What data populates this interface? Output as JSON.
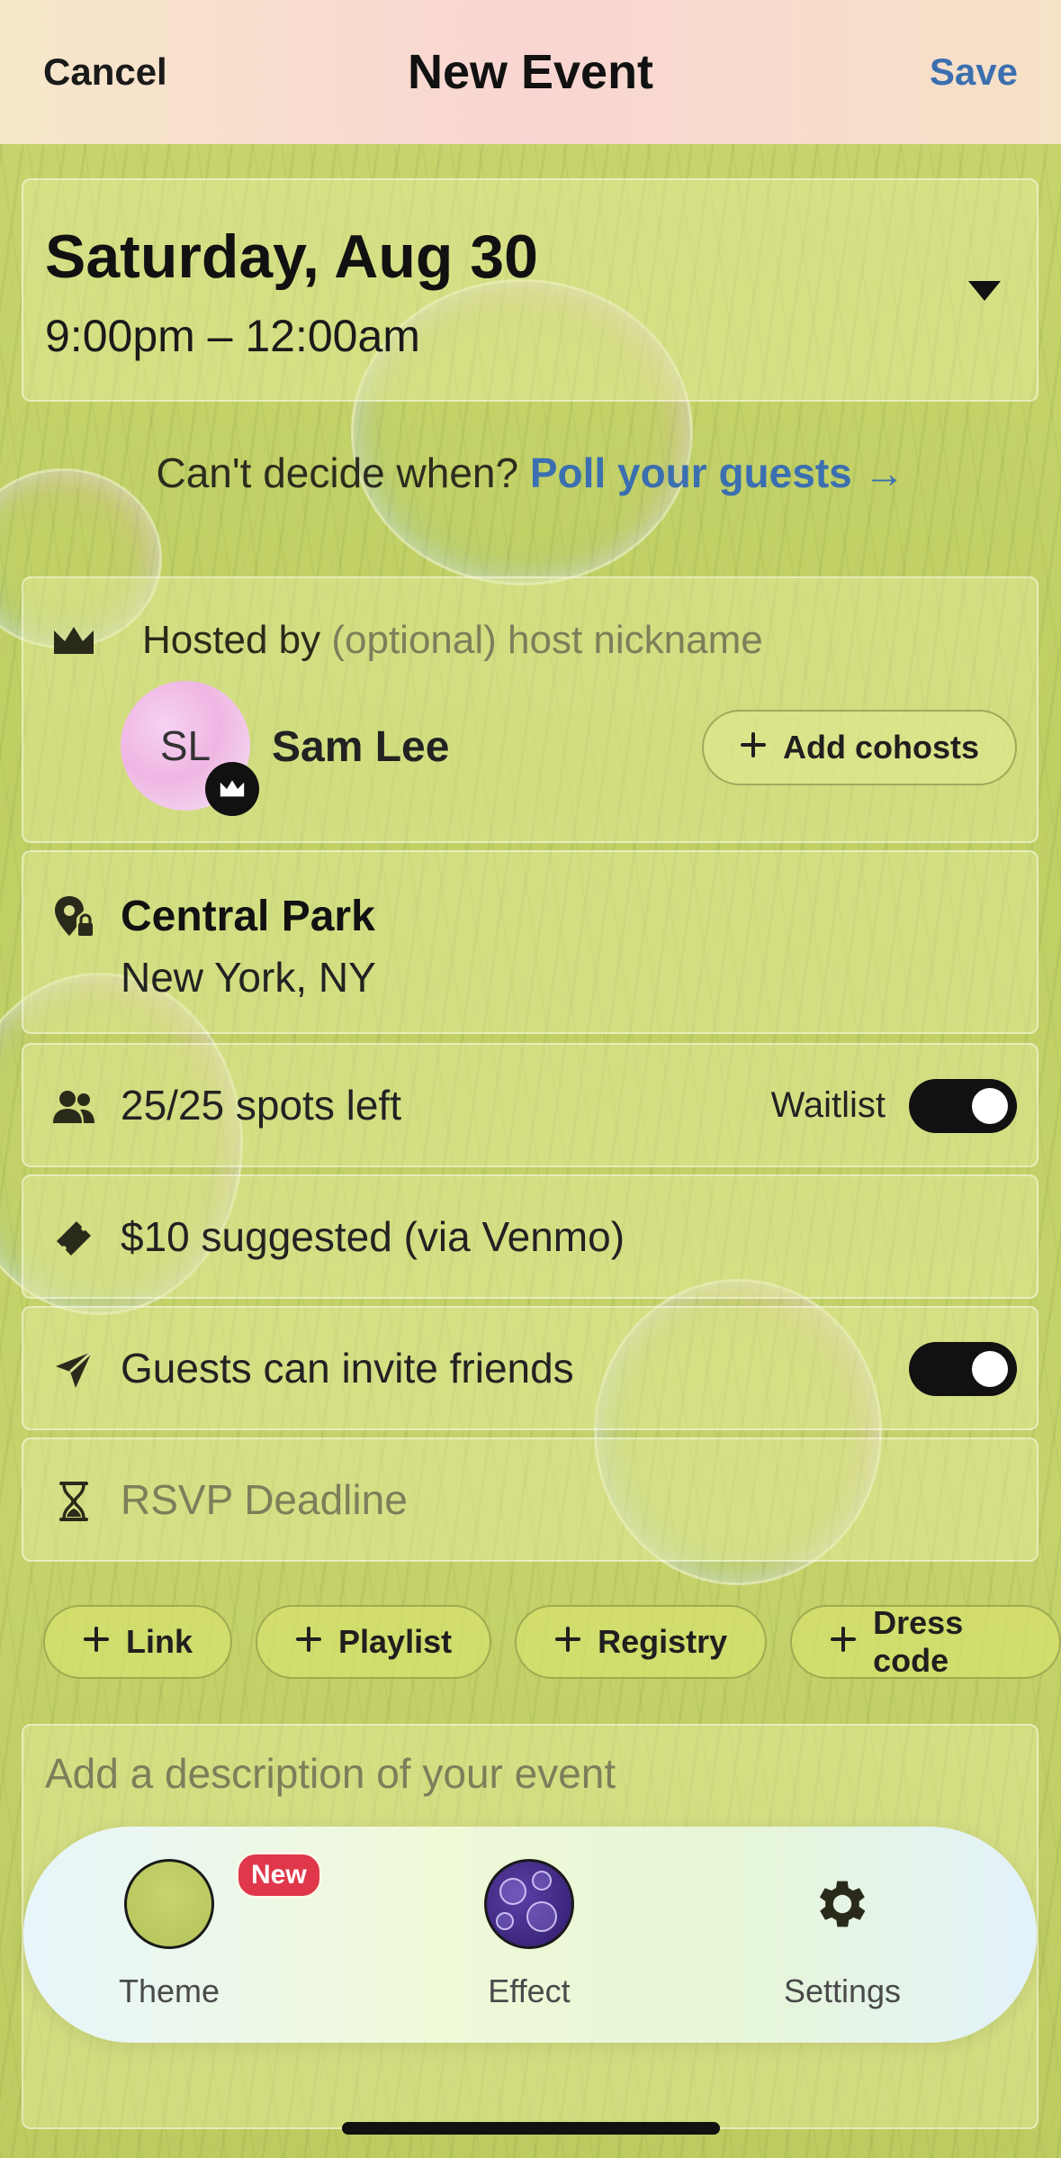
{
  "header": {
    "cancel": "Cancel",
    "title": "New Event",
    "save": "Save"
  },
  "date": {
    "day": "Saturday, Aug 30",
    "time": "9:00pm – 12:00am"
  },
  "poll": {
    "prompt": "Can't decide when?",
    "link": "Poll your guests →"
  },
  "host": {
    "label_prefix": "Hosted by",
    "label_placeholder": "(optional) host nickname",
    "initials": "SL",
    "name": "Sam Lee",
    "add_cohosts": "Add cohosts"
  },
  "location": {
    "name": "Central Park",
    "city": "New York, NY"
  },
  "spots": {
    "text": "25/25 spots left",
    "waitlist_label": "Waitlist",
    "waitlist_on": true
  },
  "price": {
    "text": "$10 suggested (via Venmo)"
  },
  "invite": {
    "text": "Guests can invite friends",
    "enabled": true
  },
  "rsvp": {
    "placeholder": "RSVP Deadline"
  },
  "chips": [
    "Link",
    "Playlist",
    "Registry",
    "Dress code"
  ],
  "description": {
    "placeholder": "Add a description of your event"
  },
  "dock": {
    "theme": "Theme",
    "theme_badge": "New",
    "effect": "Effect",
    "settings": "Settings"
  },
  "colors": {
    "accent_link": "#3b6fb0",
    "badge_red": "#e0374b",
    "toggle_on": "#111111"
  },
  "icons": [
    "crown-icon",
    "location-lock-icon",
    "people-icon",
    "ticket-icon",
    "send-icon",
    "hourglass-icon",
    "plus-icon",
    "gear-icon"
  ]
}
